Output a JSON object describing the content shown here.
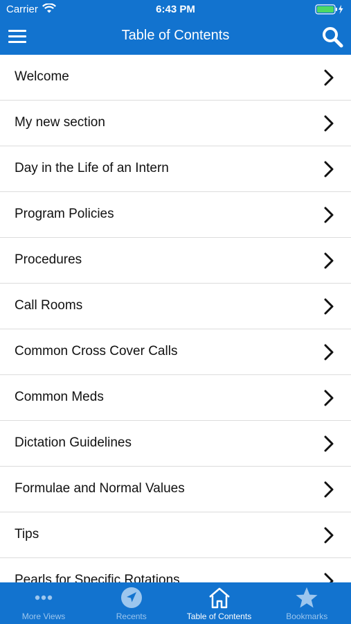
{
  "status_bar": {
    "carrier": "Carrier",
    "time": "6:43 PM"
  },
  "header": {
    "title": "Table of Contents",
    "menu_icon": "hamburger-menu-icon",
    "search_icon": "search-icon"
  },
  "toc": {
    "items": [
      "Welcome",
      "My new section",
      "Day in the Life of an Intern",
      "Program Policies",
      "Procedures",
      "Call Rooms",
      "Common Cross Cover Calls",
      "Common Meds",
      "Dictation Guidelines",
      "Formulae and Normal Values",
      "Tips",
      "Pearls for Specific Rotations"
    ]
  },
  "tab_bar": {
    "active": "Table of Contents",
    "tabs": [
      {
        "label": "More Views",
        "icon": "more-dots-icon"
      },
      {
        "label": "Recents",
        "icon": "location-arrow-icon"
      },
      {
        "label": "Table of Contents",
        "icon": "home-icon"
      },
      {
        "label": "Bookmarks",
        "icon": "star-icon"
      }
    ]
  },
  "colors": {
    "brand": "#1273cf",
    "inactive_tab": "#9cc6ee",
    "divider": "#dcdcdc"
  }
}
